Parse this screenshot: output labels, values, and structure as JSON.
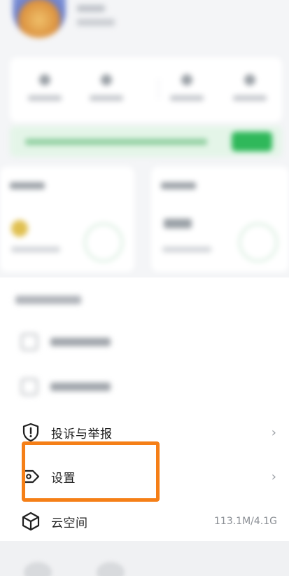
{
  "menu": {
    "complaint_label": "投诉与举报",
    "settings_label": "设置",
    "cloud_label": "云空间",
    "cloud_usage": "113.1M/4.1G",
    "chevron": "›"
  },
  "colors": {
    "highlight": "#f57f17",
    "accent_green": "#2fb85a"
  },
  "icons": {
    "complaint": "exclamation-shield-icon",
    "settings": "tag-icon",
    "cloud": "cube-icon"
  }
}
